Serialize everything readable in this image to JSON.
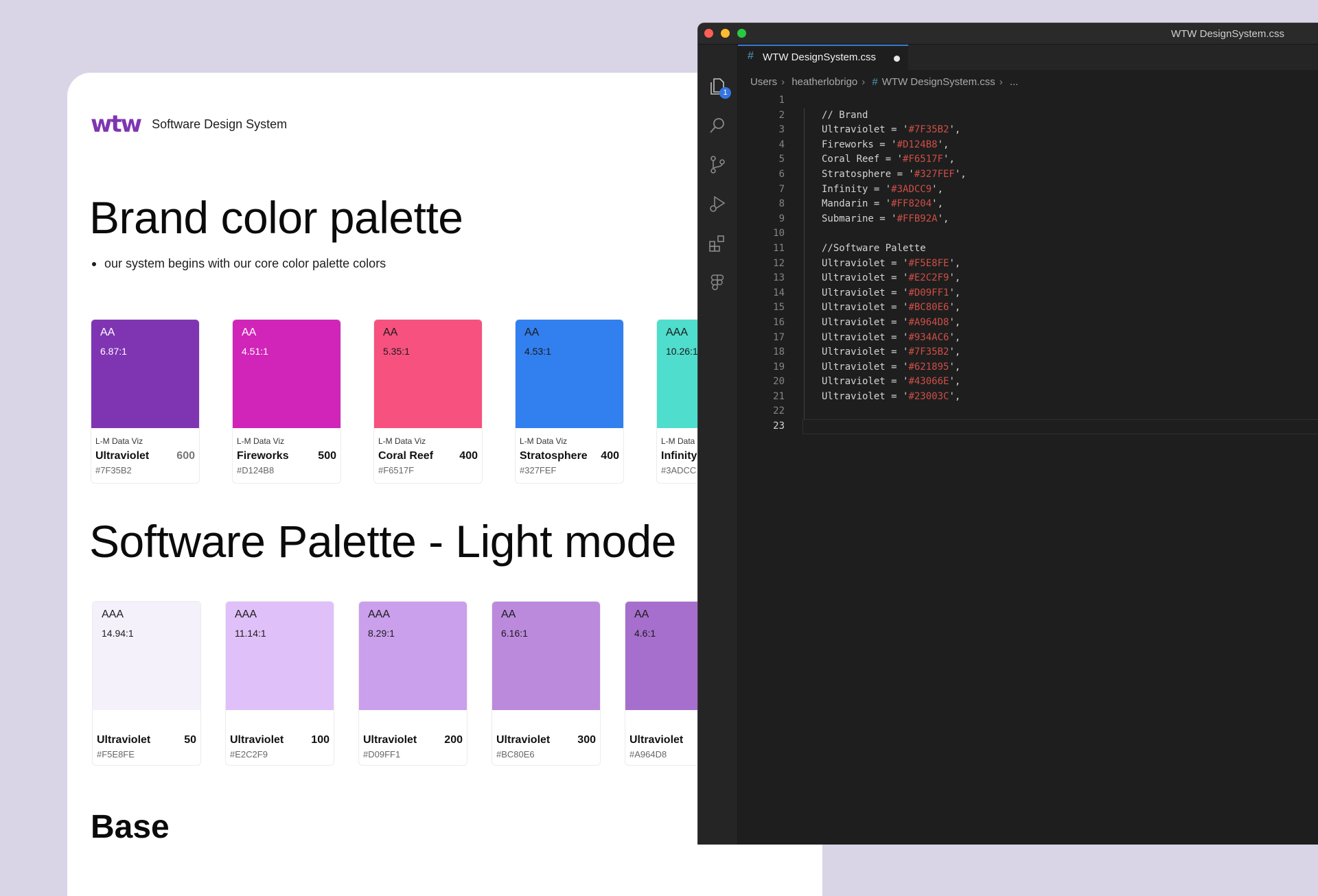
{
  "doc": {
    "logo": "wtw",
    "subtitle": "Software Design System",
    "brand_heading": "Brand color palette",
    "bullet": "our system begins with our core color palette colors",
    "software_heading": "Software Palette - Light mode",
    "base_heading": "Base",
    "brand_cards": [
      {
        "rating": "AA",
        "ratio": "6.87:1",
        "category": "L-M Data Viz",
        "name": "Ultraviolet",
        "weight": "600",
        "hex": "#7F35B2",
        "color": "#7F35B2",
        "text_color": "#ffffff"
      },
      {
        "rating": "AA",
        "ratio": "4.51:1",
        "category": "L-M Data Viz",
        "name": "Fireworks",
        "weight": "500",
        "hex": "#D124B8",
        "color": "#D124B8",
        "text_color": "#ffffff"
      },
      {
        "rating": "AA",
        "ratio": "5.35:1",
        "category": "L-M Data Viz",
        "name": "Coral Reef",
        "weight": "400",
        "hex": "#F6517F",
        "color": "#F6517F",
        "text_color": "#1a1a1a"
      },
      {
        "rating": "AA",
        "ratio": "4.53:1",
        "category": "L-M Data Viz",
        "name": "Stratosphere",
        "weight": "400",
        "hex": "#327FEF",
        "color": "#327FEF",
        "text_color": "#1a1a1a"
      },
      {
        "rating": "AAA",
        "ratio": "10.26:1",
        "category": "L-M Data",
        "name": "Infinity",
        "weight": "",
        "hex": "#3ADCC",
        "color": "#4FDDCD",
        "text_color": "#1a1a1a"
      }
    ],
    "software_cards": [
      {
        "rating": "AAA",
        "ratio": "14.94:1",
        "name": "Ultraviolet",
        "weight": "50",
        "hex": "#F5E8FE",
        "color": "#F5F1FB",
        "text_color": "#1a1a1a"
      },
      {
        "rating": "AAA",
        "ratio": "11.14:1",
        "name": "Ultraviolet",
        "weight": "100",
        "hex": "#E2C2F9",
        "color": "#E0C0F8",
        "text_color": "#1a1a1a"
      },
      {
        "rating": "AAA",
        "ratio": "8.29:1",
        "name": "Ultraviolet",
        "weight": "200",
        "hex": "#D09FF1",
        "color": "#CA9FEB",
        "text_color": "#1a1a1a"
      },
      {
        "rating": "AA",
        "ratio": "6.16:1",
        "name": "Ultraviolet",
        "weight": "300",
        "hex": "#BC80E6",
        "color": "#BB8ADD",
        "text_color": "#1a1a1a"
      },
      {
        "rating": "AA",
        "ratio": "4.6:1",
        "name": "Ultraviolet",
        "weight": "",
        "hex": "#A964D8",
        "color": "#A66FCE",
        "text_color": "#1a1a1a"
      }
    ]
  },
  "editor": {
    "window_title": "WTW DesignSystem.css",
    "tab_label": "WTW DesignSystem.css",
    "explorer_badge": "1",
    "breadcrumbs": {
      "part1": "Users",
      "part2": "heatherlobrigo",
      "file": "WTW DesignSystem.css",
      "more": "..."
    },
    "active_line": 23,
    "lines": [
      {
        "n": "1",
        "code": "",
        "val": "",
        "tail": ""
      },
      {
        "n": "2",
        "code": "// Brand",
        "val": "",
        "tail": ""
      },
      {
        "n": "3",
        "code": "Ultraviolet = '",
        "val": "#7F35B2",
        "tail": "',"
      },
      {
        "n": "4",
        "code": "Fireworks = '",
        "val": "#D124B8",
        "tail": "',"
      },
      {
        "n": "5",
        "code": "Coral Reef = '",
        "val": "#F6517F",
        "tail": "',"
      },
      {
        "n": "6",
        "code": "Stratosphere = '",
        "val": "#327FEF",
        "tail": "',"
      },
      {
        "n": "7",
        "code": "Infinity = '",
        "val": "#3ADCC9",
        "tail": "',"
      },
      {
        "n": "8",
        "code": "Mandarin = '",
        "val": "#FF8204",
        "tail": "',"
      },
      {
        "n": "9",
        "code": "Submarine = '",
        "val": "#FFB92A",
        "tail": "',"
      },
      {
        "n": "10",
        "code": "",
        "val": "",
        "tail": ""
      },
      {
        "n": "11",
        "code": "//Software Palette",
        "val": "",
        "tail": ""
      },
      {
        "n": "12",
        "code": "Ultraviolet = '",
        "val": "#F5E8FE",
        "tail": "',"
      },
      {
        "n": "13",
        "code": "Ultraviolet = '",
        "val": "#E2C2F9",
        "tail": "',"
      },
      {
        "n": "14",
        "code": "Ultraviolet = '",
        "val": "#D09FF1",
        "tail": "',"
      },
      {
        "n": "15",
        "code": "Ultraviolet = '",
        "val": "#BC80E6",
        "tail": "',"
      },
      {
        "n": "16",
        "code": "Ultraviolet = '",
        "val": "#A964D8",
        "tail": "',"
      },
      {
        "n": "17",
        "code": "Ultraviolet = '",
        "val": "#934AC6",
        "tail": "',"
      },
      {
        "n": "18",
        "code": "Ultraviolet = '",
        "val": "#7F35B2",
        "tail": "',"
      },
      {
        "n": "19",
        "code": "Ultraviolet = '",
        "val": "#621895",
        "tail": "',"
      },
      {
        "n": "20",
        "code": "Ultraviolet = '",
        "val": "#43066E",
        "tail": "',"
      },
      {
        "n": "21",
        "code": "Ultraviolet = '",
        "val": "#23003C",
        "tail": "',"
      },
      {
        "n": "22",
        "code": "",
        "val": "",
        "tail": ""
      },
      {
        "n": "23",
        "code": "",
        "val": "",
        "tail": ""
      }
    ]
  }
}
